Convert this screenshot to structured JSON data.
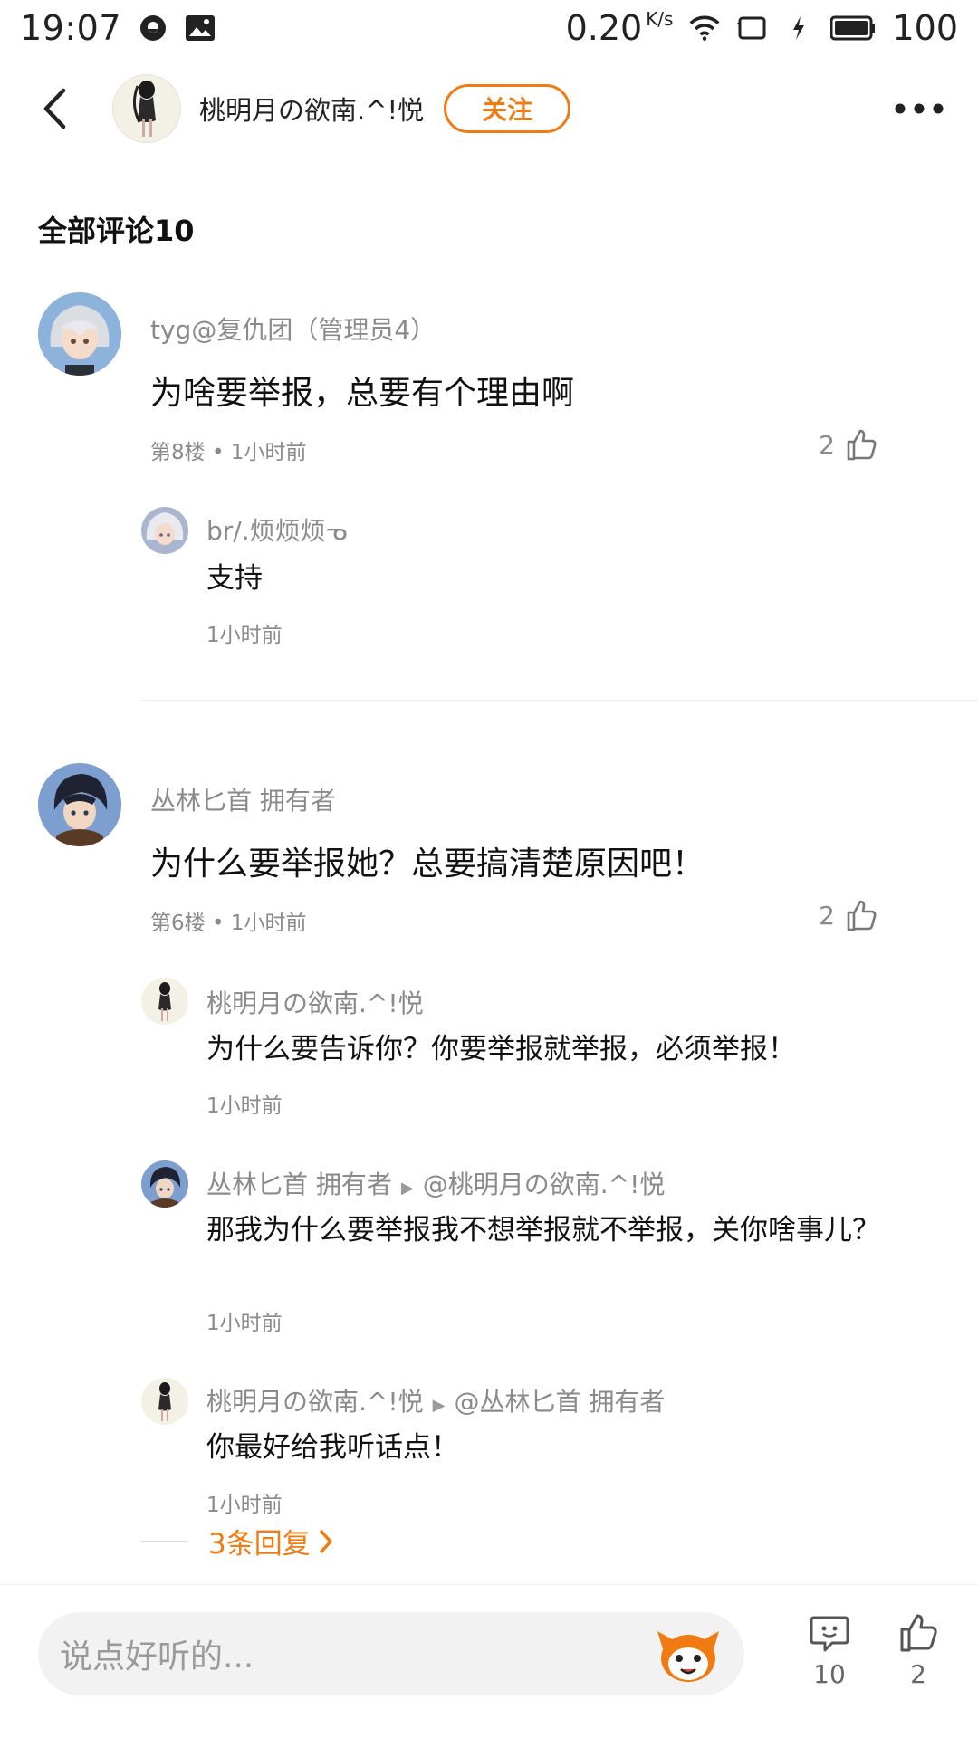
{
  "status_bar": {
    "time": "19:07",
    "net_speed": "0.20",
    "net_unit": "K/s",
    "battery": "100",
    "icons": [
      "chat-bubble-icon",
      "image-icon",
      "wifi-icon",
      "screen-icon",
      "charging-icon",
      "battery-icon"
    ]
  },
  "header": {
    "user_name": "桃明月の欲南.^!悦",
    "follow_label": "关注",
    "icons": [
      "back-arrow-icon",
      "more-dots-icon"
    ]
  },
  "section": {
    "title": "全部评论10"
  },
  "comments": [
    {
      "user": "tyg@复仇团（管理员4）",
      "text": "为啥要举报，总要有个理由啊",
      "meta": "第8楼 • 1小时前",
      "likes": "2",
      "replies": [
        {
          "user": "br/.烦烦烦ᓀ",
          "text": "支持",
          "meta": "1小时前"
        }
      ]
    },
    {
      "user": "丛林匕首  拥有者",
      "text": "为什么要举报她？总要搞清楚原因吧！",
      "meta": "第6楼 • 1小时前",
      "likes": "2",
      "replies": [
        {
          "user": "桃明月の欲南.^!悦",
          "text": "为什么要告诉你？你要举报就举报，必须举报！",
          "meta": "1小时前"
        },
        {
          "user": "丛林匕首  拥有者",
          "target": "@桃明月の欲南.^!悦",
          "text": "那我为什么要举报我不想举报就不举报，关你啥事儿？",
          "meta": "1小时前"
        },
        {
          "user": "桃明月の欲南.^!悦",
          "target": "@丛林匕首  拥有者",
          "text": "你最好给我听话点！",
          "meta": "1小时前"
        }
      ],
      "more_replies": "3条回复"
    }
  ],
  "bottom_bar": {
    "placeholder": "说点好听的...",
    "comment_count": "10",
    "like_count": "2",
    "accent": "#f07b13"
  }
}
